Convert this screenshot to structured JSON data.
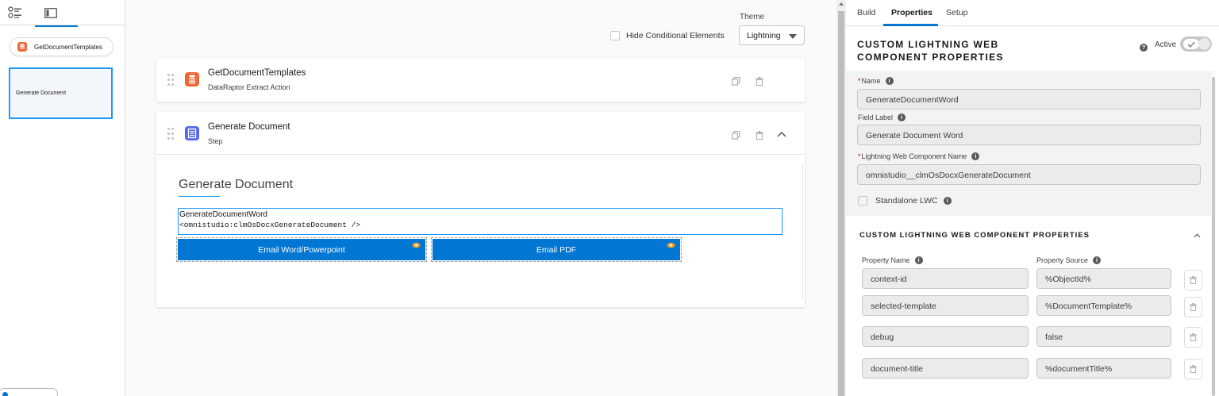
{
  "left_rail": {
    "tabs": [
      {
        "icon": "list-icon"
      },
      {
        "icon": "panel-icon"
      }
    ],
    "elements": [
      {
        "label": "GetDocumentTemplates",
        "icon": "dataraptor-icon"
      },
      {
        "label": "Generate Document"
      }
    ]
  },
  "canvas": {
    "theme_label": "Theme",
    "theme_value": "Lightning",
    "hide_conditional_label": "Hide Conditional Elements",
    "blocks": [
      {
        "title": "GetDocumentTemplates",
        "subtitle": "DataRaptor Extract Action",
        "icon": "dataraptor-icon",
        "color": "#ee6837"
      },
      {
        "title": "Generate Document",
        "subtitle": "Step",
        "icon": "step-icon",
        "color": "#5867e8"
      }
    ],
    "step": {
      "heading": "Generate Document",
      "lwc_name": "GenerateDocumentWord",
      "lwc_tag": "<omnistudio:clmOsDocxGenerateDocument />",
      "buttons": [
        "Email Word/Powerpoint",
        "Email PDF"
      ]
    }
  },
  "panel": {
    "tabs": [
      "Build",
      "Properties",
      "Setup"
    ],
    "active_tab": "Properties",
    "header_line1": "CUSTOM LIGHTNING WEB",
    "header_line2": "COMPONENT PROPERTIES",
    "active_label": "Active",
    "active": true,
    "fields": {
      "name_label": "Name",
      "name_value": "GenerateDocumentWord",
      "field_label_label": "Field Label",
      "field_label_value": "Generate Document Word",
      "lwc_name_label": "Lightning Web Component Name",
      "lwc_name_value": "omnistudio__clmOsDocxGenerateDocument",
      "standalone_label": "Standalone LWC"
    },
    "section_title": "CUSTOM LIGHTNING WEB COMPONENT PROPERTIES",
    "col_name": "Property Name",
    "col_source": "Property Source",
    "properties": [
      {
        "name": "context-id",
        "source": "%ObjectId%"
      },
      {
        "name": "selected-template",
        "source": "%DocumentTemplate%"
      },
      {
        "name": "debug",
        "source": "false"
      },
      {
        "name": "document-title",
        "source": "%documentTitle%"
      }
    ]
  },
  "colors": {
    "brand": "#0176d3",
    "focus": "#1b96ff",
    "dataraptor": "#ee6837",
    "step": "#5867e8"
  }
}
